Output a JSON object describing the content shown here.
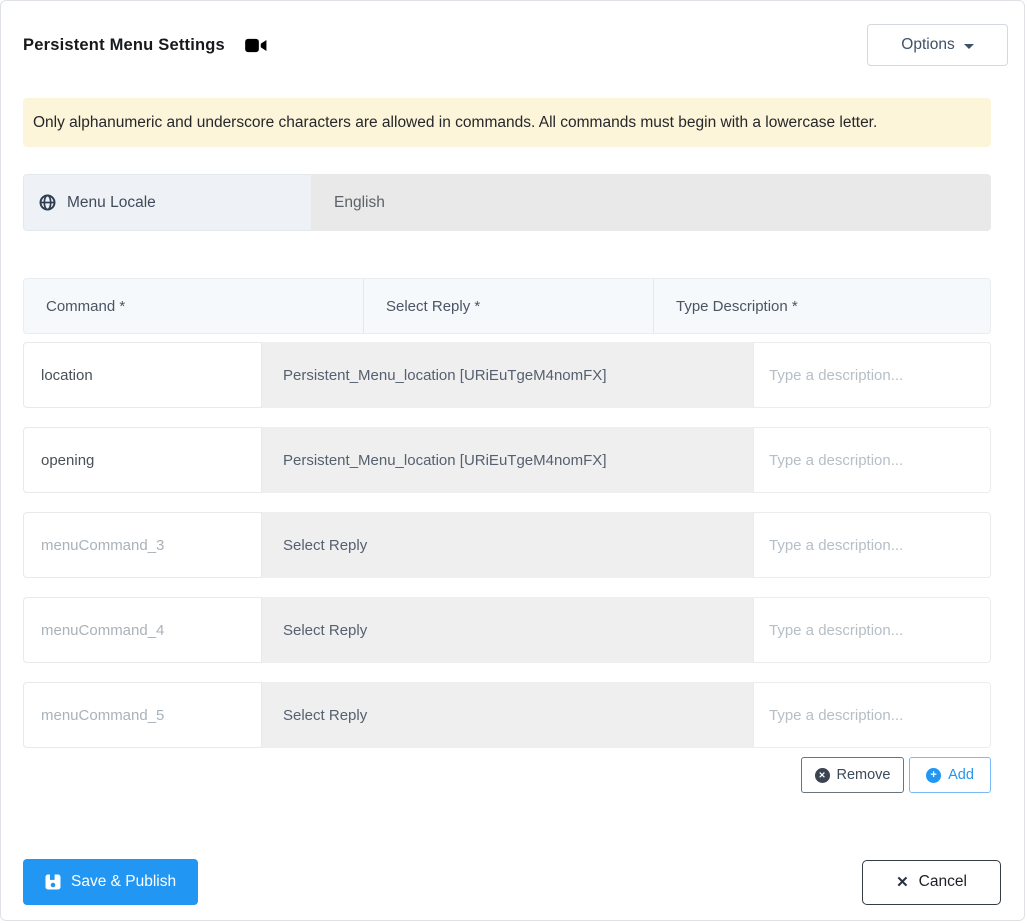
{
  "header": {
    "title": "Persistent Menu Settings",
    "title_icon": "video-camera-icon",
    "options_label": "Options"
  },
  "banner": {
    "text": "Only alphanumeric and underscore characters are allowed in commands. All commands must begin with a lowercase letter."
  },
  "locale": {
    "icon": "globe-icon",
    "label": "Menu Locale",
    "value": "English"
  },
  "table": {
    "headers": [
      "Command *",
      "Select Reply *",
      "Type Description *"
    ],
    "description_placeholder": "Type a description...",
    "reply_placeholder": "Select Reply",
    "rows": [
      {
        "command": "location",
        "command_is_placeholder": false,
        "reply": "Persistent_Menu_location [URiEuTgeM4nomFX]",
        "description": ""
      },
      {
        "command": "opening",
        "command_is_placeholder": false,
        "reply": "Persistent_Menu_location [URiEuTgeM4nomFX]",
        "description": ""
      },
      {
        "command": "menuCommand_3",
        "command_is_placeholder": true,
        "reply": "Select Reply",
        "description": ""
      },
      {
        "command": "menuCommand_4",
        "command_is_placeholder": true,
        "reply": "Select Reply",
        "description": ""
      },
      {
        "command": "menuCommand_5",
        "command_is_placeholder": true,
        "reply": "Select Reply",
        "description": ""
      }
    ]
  },
  "actions": {
    "remove_label": "Remove",
    "remove_icon": "circle-x-icon",
    "add_label": "Add",
    "add_icon": "circle-plus-icon"
  },
  "footer": {
    "save_label": "Save & Publish",
    "save_icon": "floppy-disk-icon",
    "cancel_label": "Cancel",
    "cancel_icon": "x-icon"
  },
  "colors": {
    "primary_blue": "#2196f3",
    "warning_banner_bg": "#fcf5d9",
    "disabled_field_bg": "#e9e9e9",
    "select_field_bg": "#efefef"
  }
}
